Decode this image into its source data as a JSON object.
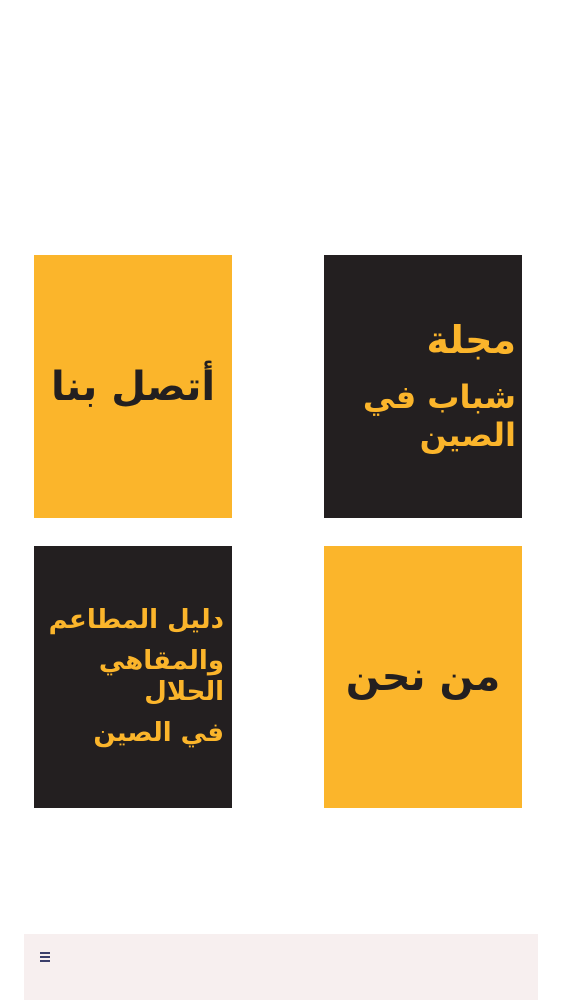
{
  "tiles": {
    "contact": {
      "label": "أتصل بنا"
    },
    "magazine": {
      "line1": "مجلة",
      "line2": "شباب في الصين"
    },
    "guide": {
      "line1": "دليل المطاعم",
      "line2": "والمقاهي الحلال",
      "line3": "في الصين"
    },
    "about": {
      "label": "من نحن"
    }
  },
  "bottom_bar": {
    "menu_icon": "hamburger-menu-icon"
  },
  "colors": {
    "yellow": "#fbb52b",
    "dark": "#231f20",
    "bottom_bar": "#f7efef",
    "icon": "#3b3f6b"
  }
}
